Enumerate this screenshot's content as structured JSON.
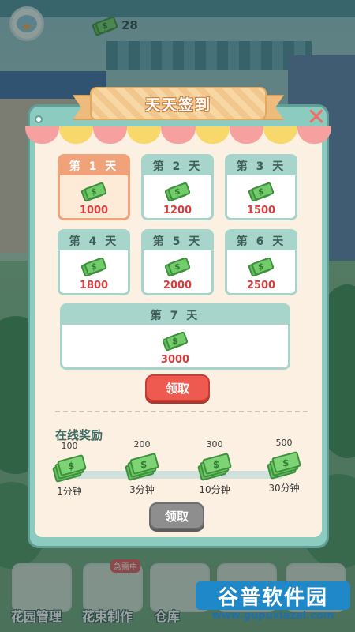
{
  "hud": {
    "money": "28"
  },
  "popup": {
    "title": "天天签到",
    "close_label": "✕",
    "days": [
      {
        "label": "第 1 天",
        "amount": "1000",
        "active": true
      },
      {
        "label": "第 2 天",
        "amount": "1200",
        "active": false
      },
      {
        "label": "第 3 天",
        "amount": "1500",
        "active": false
      },
      {
        "label": "第 4 天",
        "amount": "1800",
        "active": false
      },
      {
        "label": "第 5 天",
        "amount": "2000",
        "active": false
      },
      {
        "label": "第 6 天",
        "amount": "2500",
        "active": false
      },
      {
        "label": "第 7 天",
        "amount": "3000",
        "active": false
      }
    ],
    "claim_button": "领取",
    "online_title": "在线奖励",
    "online_progress": 0,
    "milestones": [
      {
        "value": "100",
        "time": "1分钟"
      },
      {
        "value": "200",
        "time": "3分钟"
      },
      {
        "value": "300",
        "time": "10分钟"
      },
      {
        "value": "500",
        "time": "30分钟"
      }
    ],
    "online_claim_button": "领取"
  },
  "bottom_nav": {
    "items": [
      {
        "label": "花园管理"
      },
      {
        "label": "花束制作",
        "badge": "急需中"
      },
      {
        "label": "仓库"
      }
    ]
  },
  "watermark": {
    "title": "谷普软件园",
    "url": "www.gupuxlazal.com"
  },
  "colors": {
    "accent_red": "#ee5a50",
    "panel_teal": "#8ccbbf",
    "amount_red": "#d63e3e",
    "active_orange": "#f0a37b"
  },
  "icons": [
    "avatar-icon",
    "cash-icon",
    "close-icon"
  ]
}
